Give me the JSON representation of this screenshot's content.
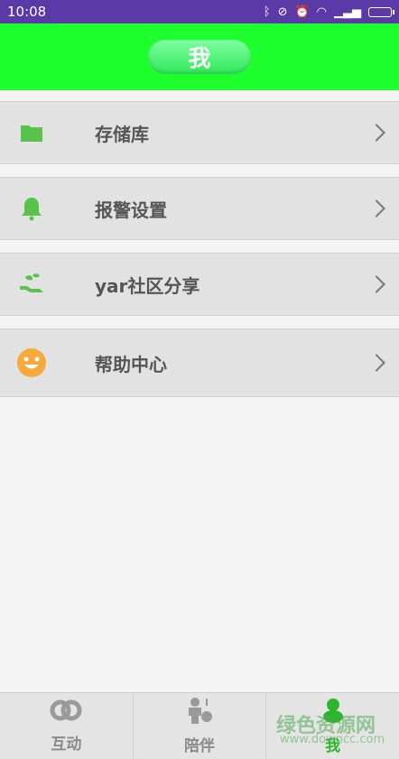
{
  "status_bar": {
    "time": "10:08",
    "icons": [
      "bluetooth-icon",
      "mute-icon",
      "alarm-icon",
      "wifi-icon",
      "signal-icon",
      "battery-icon"
    ]
  },
  "header": {
    "title": "我",
    "color": "#1eff2e"
  },
  "menu": [
    {
      "label": "存储库",
      "icon": "folder-icon"
    },
    {
      "label": "报警设置",
      "icon": "bell-icon"
    },
    {
      "label": "yar社区分享",
      "icon": "hand-leaf-icon"
    },
    {
      "label": "帮助中心",
      "icon": "smiley-icon"
    }
  ],
  "tabs": [
    {
      "label": "互动",
      "icon": "link-rings-icon",
      "active": false
    },
    {
      "label": "陪伴",
      "icon": "companion-icon",
      "active": false
    },
    {
      "label": "我",
      "icon": "profile-icon",
      "active": true
    }
  ],
  "watermark": {
    "line1": "绿色资源网",
    "line2": "www.downcc.com"
  }
}
